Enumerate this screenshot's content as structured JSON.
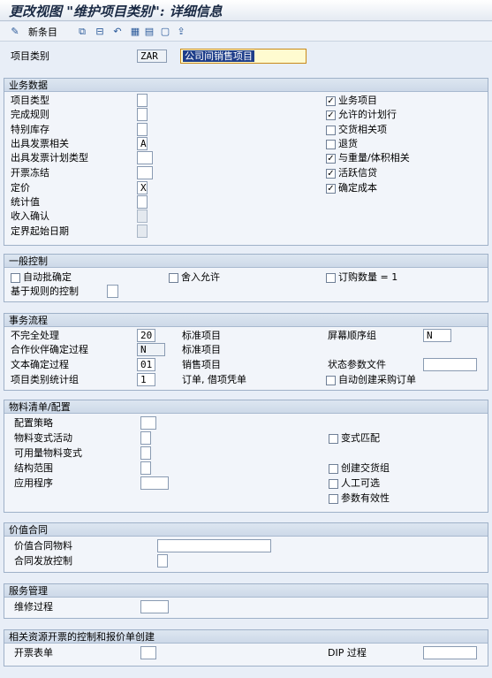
{
  "window": {
    "title": "更改视图 \"维护项目类别\": 详细信息"
  },
  "toolbar": {
    "new_entries_label": "新条目"
  },
  "header": {
    "item_category_label": "项目类别",
    "item_category_value": "ZAR",
    "item_category_desc": "公司间销售项目"
  },
  "business_data": {
    "title": "业务数据",
    "fields": [
      {
        "label": "项目类型",
        "value": ""
      },
      {
        "label": "完成规则",
        "value": ""
      },
      {
        "label": "特别库存",
        "value": ""
      },
      {
        "label": "出具发票相关",
        "value": "A"
      },
      {
        "label": "出具发票计划类型",
        "value": ""
      },
      {
        "label": "开票冻结",
        "value": ""
      },
      {
        "label": "定价",
        "value": "X"
      },
      {
        "label": "统计值",
        "value": ""
      },
      {
        "label": "收入确认",
        "value": ""
      },
      {
        "label": "定界起始日期",
        "value": ""
      }
    ],
    "checks": [
      {
        "label": "业务项目",
        "checked": "✓"
      },
      {
        "label": "允许的计划行",
        "checked": "✓"
      },
      {
        "label": "交货相关项",
        "checked": ""
      },
      {
        "label": "退货",
        "checked": ""
      },
      {
        "label": "与重量/体积相关",
        "checked": "✓"
      },
      {
        "label": "活跃信贷",
        "checked": "✓"
      },
      {
        "label": "确定成本",
        "checked": "✓"
      }
    ]
  },
  "general_control": {
    "title": "一般控制",
    "auto_batch": "自动批确定",
    "rounding": "舍入允许",
    "order_qty": "订购数量 = 1",
    "rule_based": "基于规则的控制"
  },
  "transaction_flow": {
    "title": "事务流程",
    "incompletion_label": "不完全处理",
    "incompletion_value": "20",
    "incompletion_desc": "标准项目",
    "partner_label": "合作伙伴确定过程",
    "partner_value": "N",
    "partner_desc": "标准项目",
    "text_label": "文本确定过程",
    "text_value": "01",
    "text_desc": "销售项目",
    "stat_label": "项目类别统计组",
    "stat_value": "1",
    "stat_desc": "订单, 借项凭单",
    "screen_seq_label": "屏幕顺序组",
    "screen_seq_value": "N",
    "status_profile_label": "状态参数文件",
    "status_profile_value": "",
    "auto_po_label": "自动创建采购订单"
  },
  "bom_config": {
    "title": "物料清单/配置",
    "config_strategy": "配置策略",
    "variant_activity": "物料变式活动",
    "avail_variant": "可用量物料变式",
    "struct_scope": "结构范围",
    "application": "应用程序",
    "variant_match": "变式匹配",
    "create_delivery_group": "创建交货组",
    "manual_alt": "人工可选",
    "param_effectivity": "参数有效性"
  },
  "value_contract": {
    "title": "价值合同",
    "material_label": "价值合同物料",
    "release_label": "合同发放控制"
  },
  "service_mgmt": {
    "title": "服务管理",
    "repair_label": "维修过程"
  },
  "billing_quote": {
    "title": "相关资源开票的控制和报价单创建",
    "billing_form_label": "开票表单",
    "dip_label": "DIP 过程"
  }
}
